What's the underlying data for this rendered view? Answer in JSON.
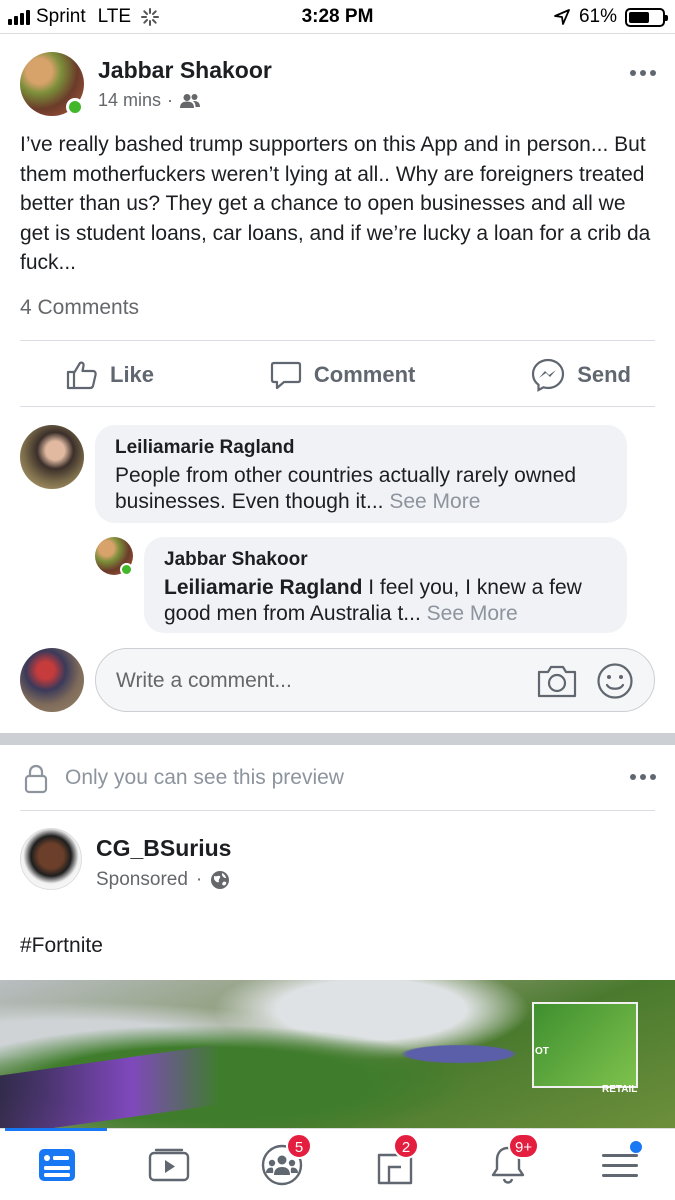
{
  "status_bar": {
    "carrier": "Sprint",
    "network": "LTE",
    "time": "3:28 PM",
    "battery_percent": "61%",
    "battery_level": 0.61
  },
  "post": {
    "author": "Jabbar Shakoor",
    "time": "14 mins",
    "audience_icon": "friends-icon",
    "text": "I’ve really bashed trump supporters on this App and in person... But them motherfuckers weren’t lying at all.. Why are foreigners treated better than us? They get a chance to open businesses and all we get is student loans, car loans, and if we’re lucky a loan for a crib da fuck...",
    "comments_count": "4 Comments",
    "actions": {
      "like": "Like",
      "comment": "Comment",
      "send": "Send"
    }
  },
  "comments": [
    {
      "author": "Leiliamarie Ragland",
      "text": "People from other countries actually rarely owned businesses. Even though it...",
      "see_more": "See More"
    },
    {
      "author": "Jabbar Shakoor",
      "mention": "Leiliamarie Ragland",
      "text": " I feel you, I knew a few good men from Australia t...",
      "see_more": "See More"
    }
  ],
  "write_comment": {
    "placeholder": "Write a comment..."
  },
  "sponsored": {
    "privacy_note": "Only you can see this preview",
    "advertiser": "CG_BSurius",
    "label": "Sponsored",
    "hashtag": "#Fortnite",
    "game_labels": [
      "OT",
      "RETAIL"
    ]
  },
  "tabbar": {
    "groups_badge": "5",
    "marketplace_badge": "2",
    "notifications_badge": "9+"
  },
  "colors": {
    "accent": "#1877f2",
    "online": "#42b72a",
    "badge": "#e41e3f"
  }
}
